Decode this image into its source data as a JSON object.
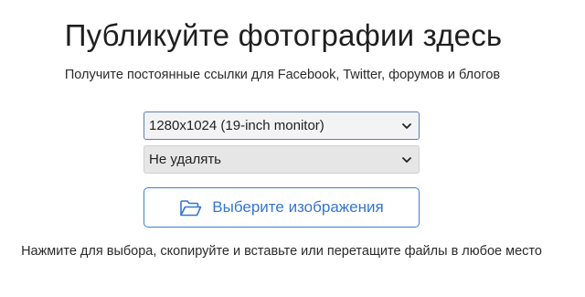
{
  "header": {
    "title": "Публикуйте фотографии здесь",
    "subtitle": "Получите постоянные ссылки для Facebook, Twitter, форумов и блогов"
  },
  "options": {
    "resize": {
      "selected": "1280x1024 (19-inch monitor)",
      "icon": "chevron-down-icon"
    },
    "expiration": {
      "selected": "Не удалять",
      "icon": "chevron-down-icon"
    }
  },
  "upload": {
    "label": "Выберите изображения",
    "icon": "folder-open-icon",
    "accent_color": "#3575d3"
  },
  "hint": "Нажмите для выбора, скопируйте и вставьте или перетащите файлы в любое место"
}
